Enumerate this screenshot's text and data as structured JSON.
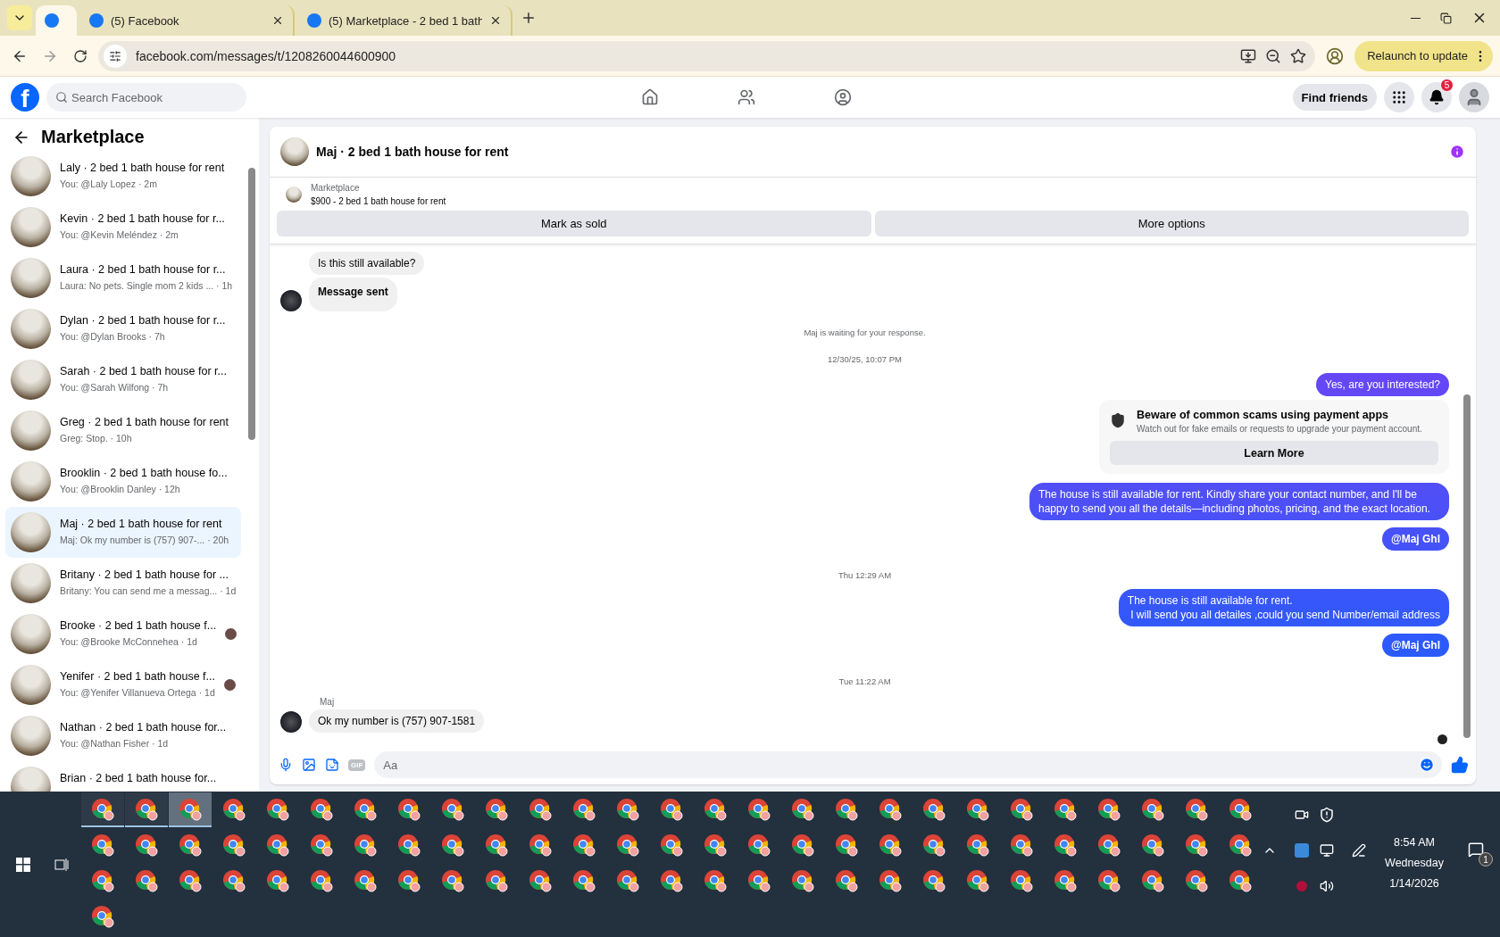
{
  "browser": {
    "tabs": [
      {
        "selected": true
      },
      {
        "title": "(5) Facebook",
        "selected": false
      },
      {
        "title": "(5) Marketplace - 2 bed 1 bath",
        "selected": false
      }
    ],
    "url": "facebook.com/messages/t/1208260044600900",
    "update_button": "Relaunch to update"
  },
  "facebook": {
    "logo": "f",
    "search": {
      "placeholder": "Search Facebook"
    },
    "find_friends": "Find friends",
    "notifications_badge": "5"
  },
  "sidebar": {
    "title": "Marketplace",
    "conversations": [
      {
        "title": "Laly · 2 bed 1 bath house for rent",
        "preview": "You: @Laly Lopez · 2m",
        "selected": false,
        "seen_avatar": false
      },
      {
        "title": "Kevin · 2 bed 1 bath house for r...",
        "preview": "You: @Kevin Meléndez · 2m",
        "selected": false,
        "seen_avatar": false
      },
      {
        "title": "Laura · 2 bed 1 bath house for r...",
        "preview": "Laura: No pets. Single mom 2 kids ... · 1h",
        "selected": false,
        "seen_avatar": false
      },
      {
        "title": "Dylan · 2 bed 1 bath house for r...",
        "preview": "You: @Dylan Brooks · 7h",
        "selected": false,
        "seen_avatar": false
      },
      {
        "title": "Sarah · 2 bed 1 bath house for r...",
        "preview": "You: @Sarah Wilfong · 7h",
        "selected": false,
        "seen_avatar": false
      },
      {
        "title": "Greg · 2 bed 1 bath house for rent",
        "preview": "Greg: Stop. · 10h",
        "selected": false,
        "seen_avatar": false
      },
      {
        "title": "Brooklin · 2 bed 1 bath house fo...",
        "preview": "You: @Brooklin Danley · 12h",
        "selected": false,
        "seen_avatar": false
      },
      {
        "title": "Maj · 2 bed 1 bath house for rent",
        "preview": "Maj: Ok my number is (757) 907-... · 20h",
        "selected": true,
        "seen_avatar": false
      },
      {
        "title": "Britany · 2 bed 1 bath house for ...",
        "preview": "Britany: You can send me a messag... · 1d",
        "selected": false,
        "seen_avatar": false
      },
      {
        "title": "Brooke · 2 bed 1 bath house f...",
        "preview": "You: @Brooke McConnehea · 1d",
        "selected": false,
        "seen_avatar": true
      },
      {
        "title": "Yenifer · 2 bed 1 bath house f...",
        "preview": "You: @Yenifer Villanueva Ortega · 1d",
        "selected": false,
        "seen_avatar": true
      },
      {
        "title": "Nathan · 2 bed 1 bath house for...",
        "preview": "You: @Nathan Fisher · 1d",
        "selected": false,
        "seen_avatar": false
      },
      {
        "title": "Brian · 2 bed 1 bath house for...",
        "selected": false,
        "seen_avatar": false
      }
    ]
  },
  "chat": {
    "title": "Maj · 2 bed 1 bath house for rent",
    "listing": {
      "label": "Marketplace",
      "price_title": "$900 - 2 bed 1 bath house for rent",
      "buttons": [
        "Mark as sold",
        "More options"
      ]
    },
    "messages": [
      {
        "kind": "incoming",
        "text": "Is this still available?",
        "avatar": false
      },
      {
        "kind": "incoming_bold",
        "text": "Message sent",
        "avatar": true
      },
      {
        "kind": "notice",
        "text": "Maj is waiting for your response."
      },
      {
        "kind": "timestamp",
        "text": "12/30/25, 10:07 PM"
      },
      {
        "kind": "outgoing",
        "text": "Yes, are you interested?"
      },
      {
        "kind": "warning",
        "title": "Beware of common scams using payment apps",
        "body": "Watch out for fake emails or requests to upgrade your payment account.",
        "button": "Learn More"
      },
      {
        "kind": "outgoing",
        "text": "The house is still available for rent. Kindly share your contact number, and I'll be happy to send you all the details—including photos, pricing, and the exact location."
      },
      {
        "kind": "outgoing_bold",
        "text": "@Maj Ghl"
      },
      {
        "kind": "timestamp",
        "text": "Thu 12:29 AM"
      },
      {
        "kind": "outgoing",
        "text": "The house is still available for rent.\n I will send you all detailes ,could you send Number/email address"
      },
      {
        "kind": "outgoing_bold",
        "text": "@Maj Ghl"
      },
      {
        "kind": "timestamp",
        "text": "Tue 11:22 AM"
      },
      {
        "kind": "sender",
        "text": "Maj"
      },
      {
        "kind": "incoming",
        "text": "Ok my number is (757) 907-1581",
        "avatar": true
      },
      {
        "kind": "seen"
      }
    ],
    "composer": {
      "placeholder": "Aa",
      "gif": "GIF"
    }
  },
  "taskbar": {
    "apps": [
      {
        "open": true,
        "selected": false
      },
      {
        "open": true,
        "selected": false
      },
      {
        "open": true,
        "selected": true
      },
      {
        "open": false,
        "selected": false
      },
      {
        "open": false,
        "selected": false
      },
      {
        "open": false,
        "selected": false
      },
      {
        "open": false,
        "selected": false
      },
      {
        "open": false,
        "selected": false
      },
      {
        "open": false,
        "selected": false
      },
      {
        "open": false,
        "selected": false
      },
      {
        "open": false,
        "selected": false
      },
      {
        "open": false,
        "selected": false
      },
      {
        "open": false,
        "selected": false
      },
      {
        "open": false,
        "selected": false
      },
      {
        "open": false,
        "selected": false
      },
      {
        "open": false,
        "selected": false
      },
      {
        "open": false,
        "selected": false
      },
      {
        "open": false,
        "selected": false
      },
      {
        "open": false,
        "selected": false
      },
      {
        "open": false,
        "selected": false
      },
      {
        "open": false,
        "selected": false
      },
      {
        "open": false,
        "selected": false
      },
      {
        "open": false,
        "selected": false
      },
      {
        "open": false,
        "selected": false
      },
      {
        "open": false,
        "selected": false
      },
      {
        "open": false,
        "selected": false
      },
      {
        "open": false,
        "selected": false
      },
      {
        "open": false,
        "selected": false
      },
      {
        "open": false,
        "selected": false
      },
      {
        "open": false,
        "selected": false
      },
      {
        "open": false,
        "selected": false
      },
      {
        "open": false,
        "selected": false
      },
      {
        "open": false,
        "selected": false
      },
      {
        "open": false,
        "selected": false
      },
      {
        "open": false,
        "selected": false
      },
      {
        "open": false,
        "selected": false
      },
      {
        "open": false,
        "selected": false
      },
      {
        "open": false,
        "selected": false
      },
      {
        "open": false,
        "selected": false
      },
      {
        "open": false,
        "selected": false
      },
      {
        "open": false,
        "selected": false
      },
      {
        "open": false,
        "selected": false
      },
      {
        "open": false,
        "selected": false
      },
      {
        "open": false,
        "selected": false
      },
      {
        "open": false,
        "selected": false
      },
      {
        "open": false,
        "selected": false
      },
      {
        "open": false,
        "selected": false
      },
      {
        "open": false,
        "selected": false
      },
      {
        "open": false,
        "selected": false
      },
      {
        "open": false,
        "selected": false
      },
      {
        "open": false,
        "selected": false
      },
      {
        "open": false,
        "selected": false
      },
      {
        "open": false,
        "selected": false
      },
      {
        "open": false,
        "selected": false
      },
      {
        "open": false,
        "selected": false
      },
      {
        "open": false,
        "selected": false
      },
      {
        "open": false,
        "selected": false
      },
      {
        "open": false,
        "selected": false
      },
      {
        "open": false,
        "selected": false
      },
      {
        "open": false,
        "selected": false
      },
      {
        "open": false,
        "selected": false
      },
      {
        "open": false,
        "selected": false
      },
      {
        "open": false,
        "selected": false
      },
      {
        "open": false,
        "selected": false
      },
      {
        "open": false,
        "selected": false
      },
      {
        "open": false,
        "selected": false
      },
      {
        "open": false,
        "selected": false
      },
      {
        "open": false,
        "selected": false
      },
      {
        "open": false,
        "selected": false
      },
      {
        "open": false,
        "selected": false
      },
      {
        "open": false,
        "selected": false
      },
      {
        "open": false,
        "selected": false
      },
      {
        "open": false,
        "selected": false
      },
      {
        "open": false,
        "selected": false
      },
      {
        "open": false,
        "selected": false
      },
      {
        "open": false,
        "selected": false
      },
      {
        "open": false,
        "selected": false
      },
      {
        "open": false,
        "selected": false
      },
      {
        "open": false,
        "selected": false
      },
      {
        "open": false,
        "selected": false
      },
      {
        "open": false,
        "selected": false
      },
      {
        "open": false,
        "selected": false
      }
    ],
    "time": "8:54 AM",
    "day": "Wednesday",
    "date": "1/14/2026",
    "notification_count": "1"
  }
}
